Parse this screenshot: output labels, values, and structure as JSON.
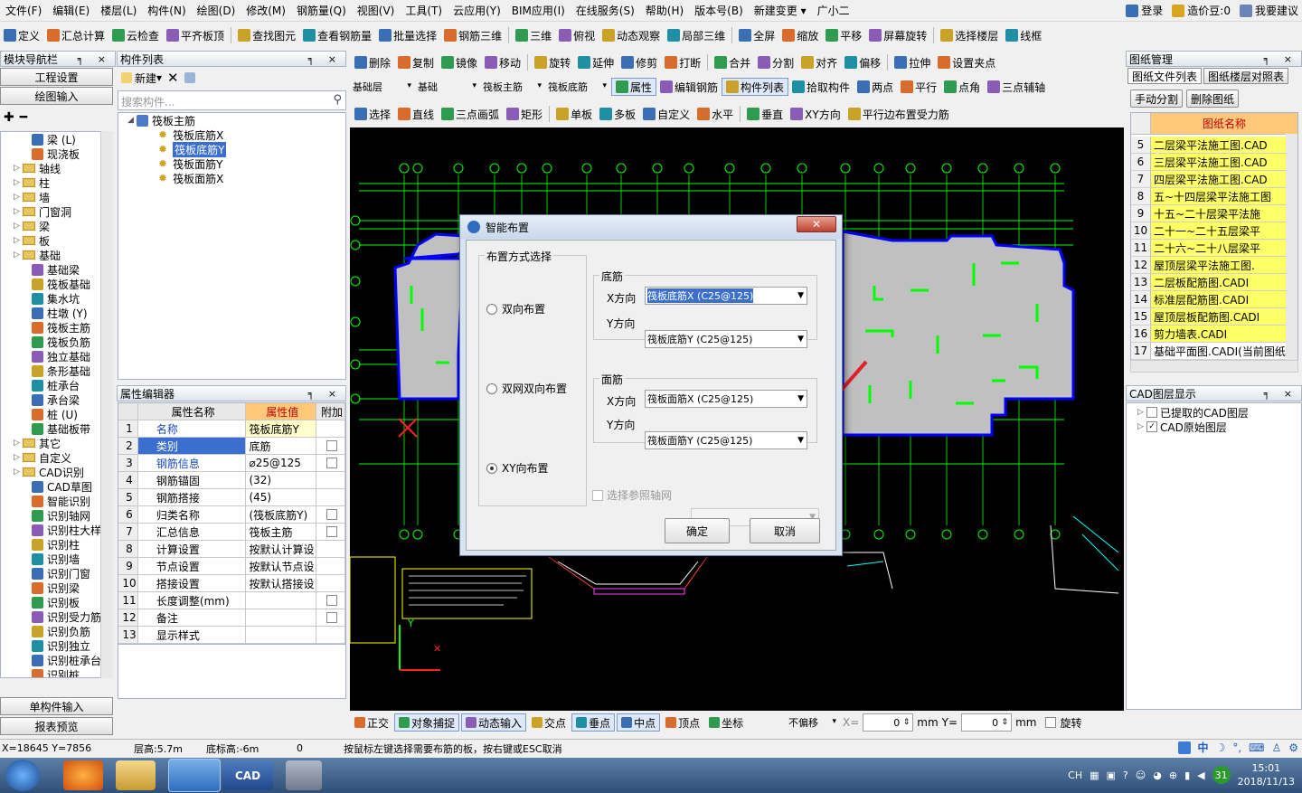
{
  "menu": [
    "文件(F)",
    "编辑(E)",
    "楼层(L)",
    "构件(N)",
    "绘图(D)",
    "修改(M)",
    "钢筋量(Q)",
    "视图(V)",
    "工具(T)",
    "云应用(Y)",
    "BIM应用(I)",
    "在线服务(S)",
    "帮助(H)",
    "版本号(B)",
    "新建变更 ▾",
    "广小二"
  ],
  "menu_right": {
    "login": "登录",
    "beans": "造价豆:0",
    "suggest": "我要建议"
  },
  "toolbar1": [
    "定义",
    "汇总计算",
    "云检查",
    "平齐板顶",
    "查找图元",
    "查看钢筋量",
    "批量选择",
    "钢筋三维",
    "三维",
    "俯视",
    "动态观察",
    "局部三维",
    "全屏",
    "缩放",
    "平移",
    "屏幕旋转",
    "选择楼层",
    "线框"
  ],
  "toolbar2": [
    "删除",
    "复制",
    "镜像",
    "移动",
    "旋转",
    "延伸",
    "修剪",
    "打断",
    "合并",
    "分割",
    "对齐",
    "偏移",
    "拉伸",
    "设置夹点"
  ],
  "toolbar3": {
    "floor": "基础层",
    "type": "基础",
    "comp": "筏板主筋",
    "sub": "筏板底筋",
    "btns": [
      "属性",
      "编辑钢筋",
      "构件列表",
      "拾取构件",
      "两点",
      "平行",
      "点角",
      "三点辅轴"
    ]
  },
  "toolbar4": [
    "选择",
    "直线",
    "三点画弧",
    "矩形",
    "单板",
    "多板",
    "自定义",
    "水平",
    "垂直",
    "XY方向",
    "平行边布置受力筋"
  ],
  "left_nav": {
    "title": "模块导航栏",
    "engineering": "工程设置",
    "drawing": "绘图输入",
    "single": "单构件输入",
    "report": "报表预览",
    "items": [
      {
        "label": "梁 (L)",
        "lvl": 2
      },
      {
        "label": "现浇板",
        "lvl": 2
      },
      {
        "label": "轴线",
        "lvl": 1
      },
      {
        "label": "柱",
        "lvl": 1
      },
      {
        "label": "墙",
        "lvl": 1
      },
      {
        "label": "门窗洞",
        "lvl": 1
      },
      {
        "label": "梁",
        "lvl": 1
      },
      {
        "label": "板",
        "lvl": 1
      },
      {
        "label": "基础",
        "lvl": 1
      },
      {
        "label": "基础梁",
        "lvl": 2
      },
      {
        "label": "筏板基础",
        "lvl": 2
      },
      {
        "label": "集水坑",
        "lvl": 2
      },
      {
        "label": "柱墩 (Y)",
        "lvl": 2
      },
      {
        "label": "筏板主筋",
        "lvl": 2
      },
      {
        "label": "筏板负筋",
        "lvl": 2
      },
      {
        "label": "独立基础",
        "lvl": 2
      },
      {
        "label": "条形基础",
        "lvl": 2
      },
      {
        "label": "桩承台",
        "lvl": 2
      },
      {
        "label": "承台梁",
        "lvl": 2
      },
      {
        "label": "桩 (U)",
        "lvl": 2
      },
      {
        "label": "基础板带",
        "lvl": 2
      },
      {
        "label": "其它",
        "lvl": 1
      },
      {
        "label": "自定义",
        "lvl": 1
      },
      {
        "label": "CAD识别",
        "lvl": 1
      },
      {
        "label": "CAD草图",
        "lvl": 2
      },
      {
        "label": "智能识别",
        "lvl": 2
      },
      {
        "label": "识别轴网",
        "lvl": 2
      },
      {
        "label": "识别柱大样",
        "lvl": 2
      },
      {
        "label": "识别柱",
        "lvl": 2
      },
      {
        "label": "识别墙",
        "lvl": 2
      },
      {
        "label": "识别门窗",
        "lvl": 2
      },
      {
        "label": "识别梁",
        "lvl": 2
      },
      {
        "label": "识别板",
        "lvl": 2
      },
      {
        "label": "识别受力筋",
        "lvl": 2
      },
      {
        "label": "识别负筋",
        "lvl": 2
      },
      {
        "label": "识别独立",
        "lvl": 2
      },
      {
        "label": "识别桩承台",
        "lvl": 2
      },
      {
        "label": "识别桩",
        "lvl": 2
      }
    ]
  },
  "comp_list": {
    "title": "构件列表",
    "new": "新建",
    "search": "搜索构件...",
    "root": "筏板主筋",
    "items": [
      "筏板底筋X",
      "筏板底筋Y",
      "筏板面筋Y",
      "筏板面筋X"
    ],
    "selected": 1
  },
  "props": {
    "title": "属性编辑器",
    "headers": [
      "属性名称",
      "属性值",
      "附加"
    ],
    "rows": [
      [
        "1",
        "名称",
        "筏板底筋Y",
        false
      ],
      [
        "2",
        "类别",
        "底筋",
        true
      ],
      [
        "3",
        "钢筋信息",
        "⌀25@125",
        true
      ],
      [
        "4",
        "钢筋锚固",
        "(32)",
        false
      ],
      [
        "5",
        "钢筋搭接",
        "(45)",
        false
      ],
      [
        "6",
        "归类名称",
        "(筏板底筋Y)",
        true
      ],
      [
        "7",
        "汇总信息",
        "筏板主筋",
        true
      ],
      [
        "8",
        "计算设置",
        "按默认计算设",
        false
      ],
      [
        "9",
        "节点设置",
        "按默认节点设",
        false
      ],
      [
        "10",
        "搭接设置",
        "按默认搭接设",
        false
      ],
      [
        "11",
        "长度调整(mm)",
        "",
        true
      ],
      [
        "12",
        "备注",
        "",
        true
      ],
      [
        "13",
        "显示样式",
        "",
        false
      ]
    ]
  },
  "dialog": {
    "title": "智能布置",
    "group": "布置方式选择",
    "options": [
      "双向布置",
      "双网双向布置",
      "XY向布置"
    ],
    "selected": 2,
    "bottom": {
      "title": "底筋",
      "x_label": "X方向",
      "x_val": "筏板底筋X (C25@125)",
      "y_label": "Y方向",
      "y_val": "筏板底筋Y (C25@125)"
    },
    "top": {
      "title": "面筋",
      "x_label": "X方向",
      "x_val": "筏板面筋X (C25@125)",
      "y_label": "Y方向",
      "y_val": "筏板面筋Y (C25@125)"
    },
    "axis_check": "选择参照轴网",
    "ok": "确定",
    "cancel": "取消"
  },
  "drawing_mgmt": {
    "title": "图纸管理",
    "tabs": [
      "图纸文件列表",
      "图纸楼层对照表"
    ],
    "btns": [
      "手动分割",
      "删除图纸"
    ],
    "col": "图纸名称",
    "rows": [
      [
        "5",
        "二层梁平法施工图.CAD"
      ],
      [
        "6",
        "三层梁平法施工图.CAD"
      ],
      [
        "7",
        "四层梁平法施工图.CAD"
      ],
      [
        "8",
        "五~十四层梁平法施工图"
      ],
      [
        "9",
        "十五~二十层梁平法施"
      ],
      [
        "10",
        "二十一~二十五层梁平"
      ],
      [
        "11",
        "二十六~二十八层梁平"
      ],
      [
        "12",
        "屋顶层梁平法施工图."
      ],
      [
        "13",
        "二层板配筋图.CADI"
      ],
      [
        "14",
        "标准层配筋图.CADI"
      ],
      [
        "15",
        "屋顶层板配筋图.CADI"
      ],
      [
        "16",
        "剪力墙表.CADI"
      ],
      [
        "17",
        "基础平面图.CADI(当前图纸)"
      ]
    ]
  },
  "cad_layers": {
    "title": "CAD图层显示",
    "items": [
      "已提取的CAD图层",
      "CAD原始图层"
    ]
  },
  "snap_bar": {
    "items": [
      "正交",
      "对象捕捉",
      "动态输入",
      "交点",
      "垂点",
      "中点",
      "顶点",
      "坐标"
    ],
    "offset": "不偏移",
    "x_label": "X=",
    "x_val": "0",
    "unit": "mm",
    "y_label": "Y=",
    "y_val": "0",
    "rotate": "旋转"
  },
  "status": {
    "coords": "X=18645 Y=7856",
    "floor_h": "层高:5.7m",
    "bottom_h": "底标高:-6m",
    "zero": "0",
    "hint": "按鼠标左键选择需要布筋的板，按右键或ESC取消"
  },
  "taskbar": {
    "lang": "CH",
    "time": "15:01",
    "date": "2018/11/13",
    "badge": "31"
  }
}
